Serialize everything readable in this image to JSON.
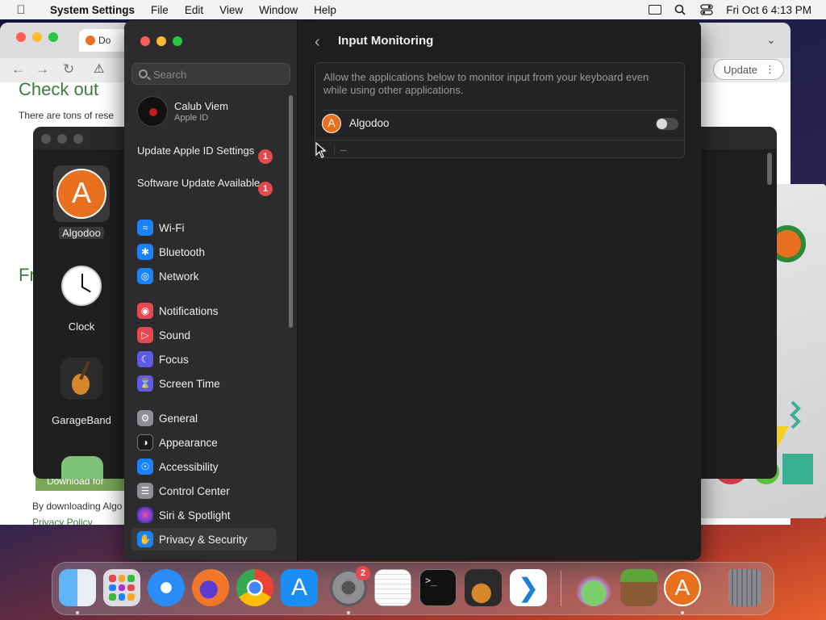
{
  "menubar": {
    "app_name": "System Settings",
    "menus": [
      "File",
      "Edit",
      "View",
      "Window",
      "Help"
    ],
    "datetime": "Fri Oct 6  4:13 PM"
  },
  "browser": {
    "tab_label": "Do",
    "heading": "Check out",
    "intro_text": "There are tons of rese",
    "heading2": "Fr",
    "download_text": "By downloading Algo",
    "privacy_link": "Privacy Policy",
    "update_label": "Update",
    "download_btn": "Download for"
  },
  "apps_window": {
    "apps": [
      {
        "name": "Algodoo"
      },
      {
        "name": "Clock"
      },
      {
        "name": "GarageBand"
      }
    ]
  },
  "settings": {
    "search_placeholder": "Search",
    "account": {
      "name": "Calub Viem",
      "subtitle": "Apple ID"
    },
    "notices": [
      {
        "label": "Update Apple ID Settings",
        "badge": "1"
      },
      {
        "label": "Software Update Available",
        "badge": "1"
      }
    ],
    "sidebar": [
      {
        "label": "Wi-Fi",
        "color": "#1a82fb"
      },
      {
        "label": "Bluetooth",
        "color": "#1a82fb"
      },
      {
        "label": "Network",
        "color": "#1a82fb"
      },
      {
        "label": "Notifications",
        "color": "#e5484d"
      },
      {
        "label": "Sound",
        "color": "#e5484d"
      },
      {
        "label": "Focus",
        "color": "#5e5ce6"
      },
      {
        "label": "Screen Time",
        "color": "#5e5ce6"
      },
      {
        "label": "General",
        "color": "#8e8e93"
      },
      {
        "label": "Appearance",
        "color": "#1c1c1e"
      },
      {
        "label": "Accessibility",
        "color": "#1a82fb"
      },
      {
        "label": "Control Center",
        "color": "#8e8e93"
      },
      {
        "label": "Siri & Spotlight",
        "color": "#b02fc4"
      },
      {
        "label": "Privacy & Security",
        "color": "#1a82fb"
      }
    ],
    "pane_title": "Input Monitoring",
    "description": "Allow the applications below to monitor input from your keyboard even while using other applications.",
    "apps": [
      {
        "name": "Algodoo",
        "enabled": false
      }
    ],
    "add_label": "+",
    "remove_label": "–"
  },
  "dock": {
    "items": [
      "finder-icon",
      "launchpad-icon",
      "safari-icon",
      "firefox-icon",
      "chrome-icon",
      "app-store-icon",
      "system-settings-icon",
      "textedit-icon",
      "terminal-icon",
      "garageband-icon",
      "vscode-icon",
      "installer-icon",
      "minecraft-icon",
      "algodoo-icon",
      "trash-icon"
    ],
    "settings_badge": "2"
  }
}
